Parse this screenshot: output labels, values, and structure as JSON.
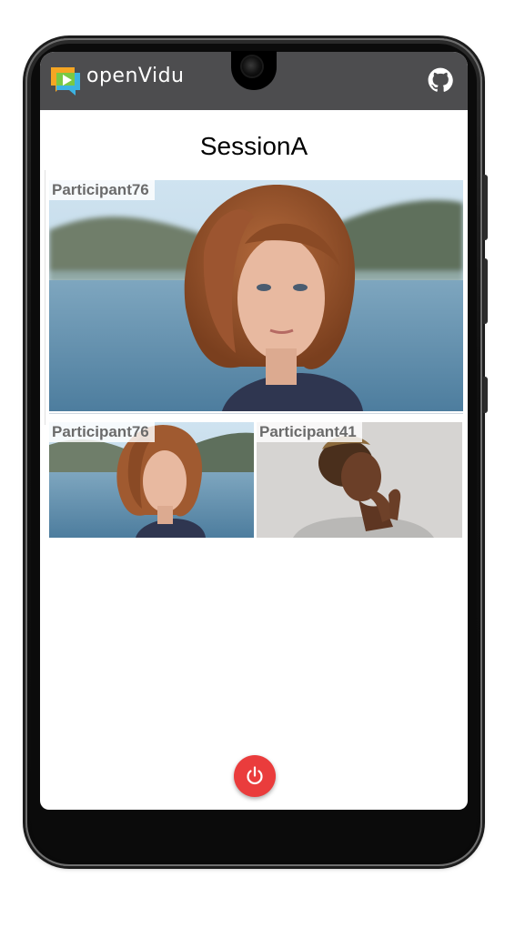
{
  "app": {
    "brand": "openVidu",
    "brand_colors": [
      "#f5a623",
      "#3bb3e3",
      "#7ac943"
    ],
    "topbar_color": "#4d4d4f",
    "header_icons": [
      "openvidu-logo-icon",
      "github-icon"
    ]
  },
  "session": {
    "title": "SessionA"
  },
  "videos": {
    "main": {
      "participant": "Participant76"
    },
    "thumbnails": [
      {
        "participant": "Participant76"
      },
      {
        "participant": "Participant41"
      }
    ]
  },
  "controls": {
    "leave_icon": "power-icon",
    "leave_color": "#ea3c3c"
  }
}
